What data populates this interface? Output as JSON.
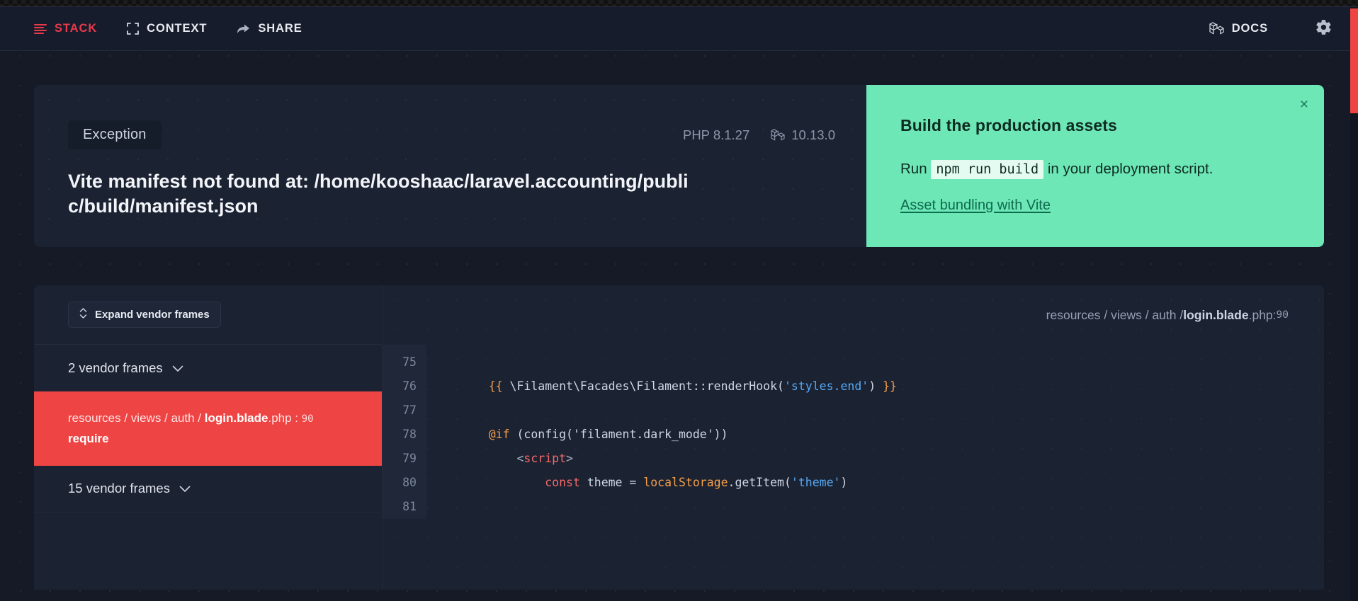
{
  "navbar": {
    "left_items": [
      {
        "label": "STACK",
        "icon": "stack-lines-icon",
        "active": true
      },
      {
        "label": "CONTEXT",
        "icon": "crop-frame-icon",
        "active": false
      },
      {
        "label": "SHARE",
        "icon": "share-arrow-icon",
        "active": false
      }
    ],
    "right_items": [
      {
        "label": "DOCS",
        "icon": "laravel-logo-icon"
      }
    ],
    "settings_icon": "gear-icon"
  },
  "exception": {
    "badge": "Exception",
    "title": "Vite manifest not found at: /home/kooshaac/laravel.accounting/public/build/manifest.json",
    "php_version": "PHP 8.1.27",
    "laravel_version": "10.13.0",
    "laravel_icon": "laravel-logo-icon"
  },
  "solution": {
    "title": "Build the production assets",
    "body_before": "Run",
    "body_code": "npm run build",
    "body_after": "in your deployment script.",
    "link": "Asset bundling with Vite",
    "close_label": "×",
    "accent_color": "#6ee7b7"
  },
  "stack": {
    "expand_button": "Expand vendor frames",
    "expand_icon": "chevron-updown-icon",
    "frames": [
      {
        "type": "vendor",
        "label": "2 vendor frames",
        "icon": "chevron-down-icon"
      },
      {
        "type": "app",
        "selected": true,
        "path_dirs": "resources / views / auth / ",
        "path_file": "login.blade",
        "path_ext": ".php",
        "path_sep": " : ",
        "line": "90",
        "method": "require"
      },
      {
        "type": "vendor",
        "label": "15 vendor frames",
        "icon": "chevron-down-icon"
      }
    ],
    "highlight_color": "#ef4444"
  },
  "code": {
    "breadcrumb": {
      "dirs": "resources / views / auth / ",
      "file": "login.blade",
      "ext": ".php",
      "sep": " : ",
      "line": "90"
    },
    "line_numbers": [
      "75",
      "76",
      "77",
      "78",
      "79",
      "80",
      "81"
    ],
    "lines": [
      {
        "n": "75",
        "tokens": []
      },
      {
        "n": "76",
        "tokens": [
          {
            "t": "    ",
            "c": "tk-plain"
          },
          {
            "t": "{{",
            "c": "tk-dir"
          },
          {
            "t": " \\Filament\\Facades\\Filament::renderHook(",
            "c": "tk-plain"
          },
          {
            "t": "'styles.end'",
            "c": "tk-str"
          },
          {
            "t": ") ",
            "c": "tk-plain"
          },
          {
            "t": "}}",
            "c": "tk-dir"
          }
        ]
      },
      {
        "n": "77",
        "tokens": []
      },
      {
        "n": "78",
        "tokens": [
          {
            "t": "    ",
            "c": "tk-plain"
          },
          {
            "t": "@if",
            "c": "tk-dir"
          },
          {
            "t": " (config(",
            "c": "tk-plain"
          },
          {
            "t": "'filament.dark_mode'",
            "c": "tk-plain"
          },
          {
            "t": "))",
            "c": "tk-plain"
          }
        ]
      },
      {
        "n": "79",
        "tokens": [
          {
            "t": "        ",
            "c": "tk-plain"
          },
          {
            "t": "<",
            "c": "tk-punct"
          },
          {
            "t": "script",
            "c": "tk-tag"
          },
          {
            "t": ">",
            "c": "tk-punct"
          }
        ]
      },
      {
        "n": "80",
        "tokens": [
          {
            "t": "            ",
            "c": "tk-plain"
          },
          {
            "t": "const",
            "c": "tk-tag"
          },
          {
            "t": " theme = ",
            "c": "tk-plain"
          },
          {
            "t": "localStorage",
            "c": "tk-obj"
          },
          {
            "t": ".getItem(",
            "c": "tk-plain"
          },
          {
            "t": "'theme'",
            "c": "tk-str"
          },
          {
            "t": ")",
            "c": "tk-plain"
          }
        ]
      },
      {
        "n": "81",
        "tokens": []
      }
    ]
  }
}
